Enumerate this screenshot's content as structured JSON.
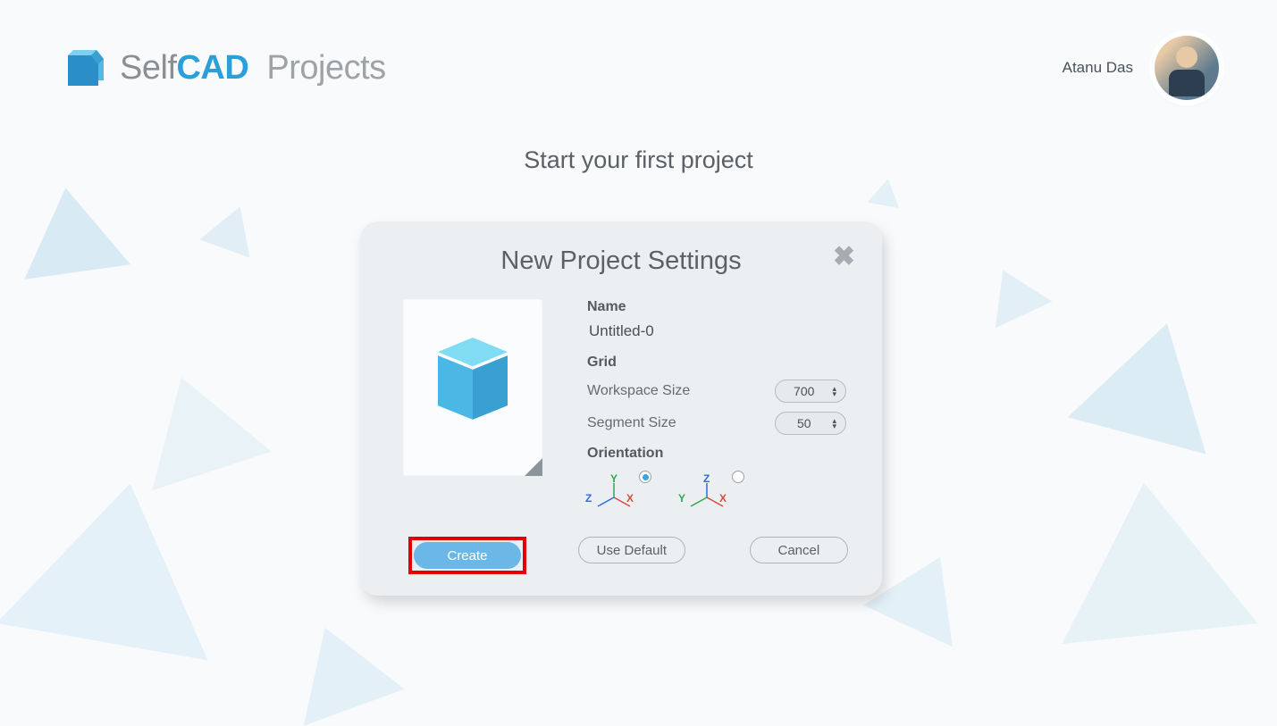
{
  "header": {
    "brand_self": "Self",
    "brand_cad": "CAD",
    "brand_projects": "Projects",
    "user_name": "Atanu Das"
  },
  "subtitle": "Start your first project",
  "dialog": {
    "title": "New Project Settings",
    "name_label": "Name",
    "name_value": "Untitled-0",
    "grid_label": "Grid",
    "workspace_label": "Workspace Size",
    "workspace_value": "700",
    "segment_label": "Segment Size",
    "segment_value": "50",
    "orientation_label": "Orientation",
    "orientation_a": {
      "up": "Y",
      "h1": "Z",
      "h2": "X",
      "selected": true
    },
    "orientation_b": {
      "up": "Z",
      "h1": "Y",
      "h2": "X",
      "selected": false
    },
    "buttons": {
      "create": "Create",
      "use_default": "Use Default",
      "cancel": "Cancel"
    }
  }
}
